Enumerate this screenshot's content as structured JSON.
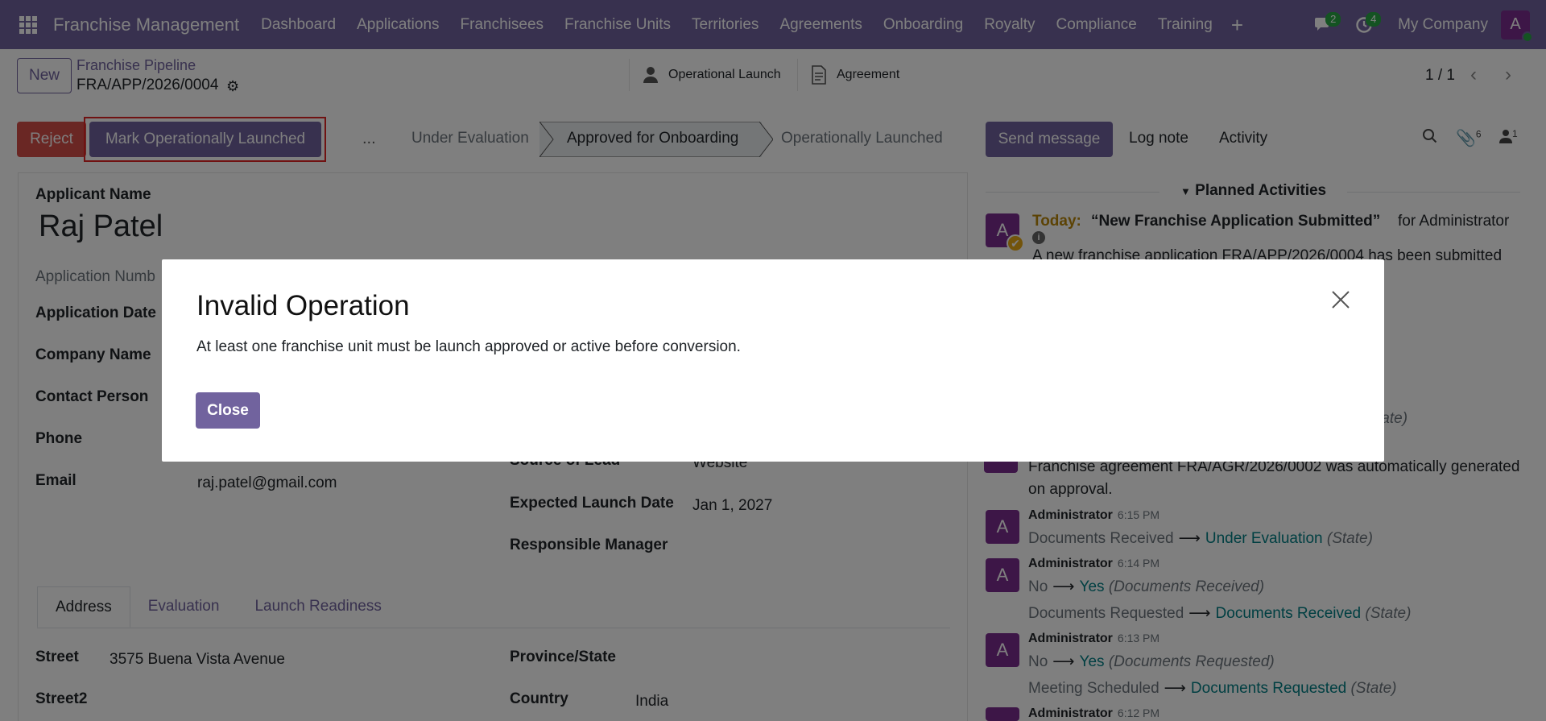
{
  "topnav": {
    "brand": "Franchise Management",
    "menu": [
      "Dashboard",
      "Applications",
      "Franchisees",
      "Franchise Units",
      "Territories",
      "Agreements",
      "Onboarding",
      "Royalty",
      "Compliance",
      "Training"
    ],
    "plus": "+",
    "messages_count": "2",
    "activities_count": "4",
    "company": "My Company",
    "avatar_letter": "A"
  },
  "control_panel": {
    "new_label": "New",
    "breadcrumb_parent": "Franchise Pipeline",
    "breadcrumb_current": "FRA/APP/2026/0004",
    "smart_buttons": [
      "Operational Launch",
      "Agreement"
    ],
    "pager": "1 / 1"
  },
  "actions": {
    "reject": "Reject",
    "mark_launched": "Mark Operationally Launched",
    "more": "...",
    "stages": [
      "Under Evaluation",
      "Approved for Onboarding",
      "Operationally Launched"
    ],
    "active_stage": "Approved for Onboarding"
  },
  "chatter_bar": {
    "send_message": "Send message",
    "log_note": "Log note",
    "activity": "Activity",
    "attachments_count": "6",
    "followers_count": "1"
  },
  "form": {
    "applicant_name_label": "Applicant Name",
    "applicant_name": "Raj Patel",
    "application_number_label": "Application Numb",
    "application_date_label": "Application Date",
    "company_name_label": "Company Name",
    "contact_person_label": "Contact Person",
    "phone_label": "Phone",
    "email_label": "Email",
    "email": "raj.patel@gmail.com",
    "source_label": "Source of Lead",
    "source": "Website",
    "expected_launch_label": "Expected Launch Date",
    "expected_launch": "Jan 1, 2027",
    "responsible_manager_label": "Responsible Manager",
    "tabs": [
      "Address",
      "Evaluation",
      "Launch Readiness"
    ],
    "street_label": "Street",
    "street": "3575  Buena Vista Avenue",
    "street2_label": "Street2",
    "province_label": "Province/State",
    "country_label": "Country",
    "country": "India"
  },
  "chatter": {
    "planned_title": "Planned Activities",
    "today": "Today:",
    "activity_title": "“New Franchise Application Submitted”",
    "activity_for": "for Administrator",
    "activity_text": "A new franchise application FRA/APP/2026/0004 has been submitted",
    "state_partial": "tate)",
    "agreement_msg": "Franchise agreement FRA/AGR/2026/0002 was automatically generated",
    "agreement_msg2": "on approval.",
    "messages": [
      {
        "author": "Administrator",
        "time": "6:15 PM",
        "changes": [
          {
            "old": "Documents Received",
            "new": "Under Evaluation",
            "field": "(State)"
          }
        ]
      },
      {
        "author": "Administrator",
        "time": "6:14 PM",
        "changes": [
          {
            "old": "No",
            "new": "Yes",
            "field": "(Documents Received)"
          },
          {
            "old": "Documents Requested",
            "new": "Documents Received",
            "field": "(State)"
          }
        ]
      },
      {
        "author": "Administrator",
        "time": "6:13 PM",
        "changes": [
          {
            "old": "No",
            "new": "Yes",
            "field": "(Documents Requested)"
          },
          {
            "old": "Meeting Scheduled",
            "new": "Documents Requested",
            "field": "(State)"
          }
        ]
      },
      {
        "author": "Administrator",
        "time": "6:12 PM",
        "changes": []
      }
    ]
  },
  "modal": {
    "title": "Invalid Operation",
    "body": "At least one franchise unit must be launch approved or active before conversion.",
    "close_label": "Close"
  },
  "colors": {
    "brand": "#71639e",
    "danger": "#d23f3a",
    "link_teal": "#017e84",
    "avatar": "#7b2d8e"
  }
}
